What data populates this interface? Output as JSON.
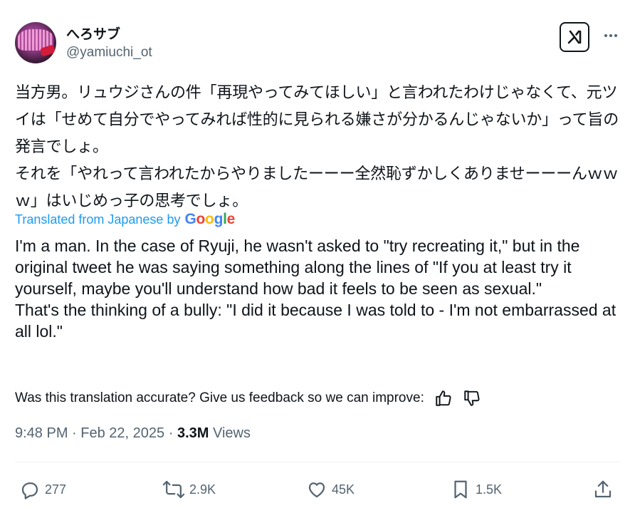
{
  "author": {
    "display_name": "へろサブ",
    "handle": "@yamiuchi_ot"
  },
  "tweet": {
    "original_text": "当方男。リュウジさんの件「再現やってみてほしい」と言われたわけじゃなくて、元ツイは「せめて自分でやってみれば性的に見られる嫌さが分かるんじゃないか」って旨の発言でしょ。\nそれを「やれって言われたからやりましたーーー全然恥ずかしくありませーーーんｗｗｗ」はいじめっ子の思考でしょ。",
    "translated_label": "Translated from Japanese by",
    "translator_name": "Google",
    "translated_text": "I'm a man. In the case of Ryuji, he wasn't asked to \"try recreating it,\" but in the original tweet he was saying something along the lines of \"If you at least try it yourself, maybe you'll understand how bad it feels to be seen as sexual.\"\nThat's the thinking of a bully: \"I did it because I was told to - I'm not embarrassed at all lol.\"",
    "feedback_prompt": "Was this translation accurate? Give us feedback so we can improve:",
    "time": "9:48 PM",
    "separator": "·",
    "date": "Feb 22, 2025",
    "views_count": "3.3M",
    "views_label": "Views"
  },
  "actions": {
    "replies": "277",
    "reposts": "2.9K",
    "likes": "45K",
    "bookmarks": "1.5K"
  },
  "icons": {
    "grok": "grok-icon",
    "more": "more-icon",
    "thumbs_up": "thumbs-up-icon",
    "thumbs_down": "thumbs-down-icon",
    "reply": "reply-icon",
    "repost": "repost-icon",
    "like": "like-icon",
    "bookmark": "bookmark-icon",
    "share": "share-icon"
  },
  "colors": {
    "text": "#0f1419",
    "secondary": "#536471",
    "link": "#1d9bf0",
    "divider": "#eff3f4"
  }
}
